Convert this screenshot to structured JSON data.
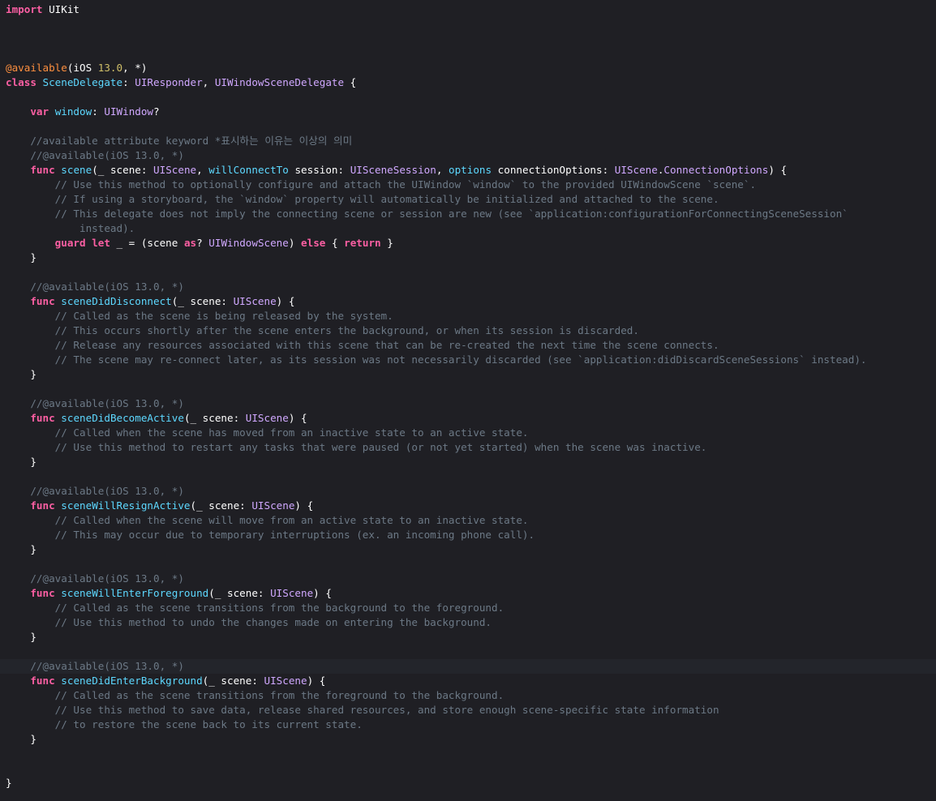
{
  "editor": {
    "theme": {
      "background": "#1f1f24",
      "current_line": "#23252b",
      "plain": "#ffffff",
      "keyword": "#fc5fa3",
      "comment": "#6c7986",
      "attribute": "#fd8f3f",
      "number": "#d0bf69",
      "declaration": "#5dd8ff",
      "type": "#d0a8ff"
    },
    "current_line_index": 45,
    "lines": [
      [
        [
          "kw",
          "import"
        ],
        [
          "plain",
          " UIKit"
        ]
      ],
      [],
      [],
      [],
      [
        [
          "attr",
          "@available"
        ],
        [
          "plain",
          "(iOS "
        ],
        [
          "num",
          "13.0"
        ],
        [
          "plain",
          ", *)"
        ]
      ],
      [
        [
          "kw",
          "class"
        ],
        [
          "plain",
          " "
        ],
        [
          "decl",
          "SceneDelegate"
        ],
        [
          "plain",
          ": "
        ],
        [
          "type",
          "UIResponder"
        ],
        [
          "plain",
          ", "
        ],
        [
          "type",
          "UIWindowSceneDelegate"
        ],
        [
          "plain",
          " {"
        ]
      ],
      [],
      [
        [
          "plain",
          "    "
        ],
        [
          "kw",
          "var"
        ],
        [
          "plain",
          " "
        ],
        [
          "decl",
          "window"
        ],
        [
          "plain",
          ": "
        ],
        [
          "type",
          "UIWindow"
        ],
        [
          "plain",
          "?"
        ]
      ],
      [],
      [
        [
          "plain",
          "    "
        ],
        [
          "comment",
          "//available attribute keyword *표시하는 이유는 이상의 의미"
        ]
      ],
      [
        [
          "plain",
          "    "
        ],
        [
          "comment",
          "//@available(iOS 13.0, *)"
        ]
      ],
      [
        [
          "plain",
          "    "
        ],
        [
          "kw",
          "func"
        ],
        [
          "plain",
          " "
        ],
        [
          "decl",
          "scene"
        ],
        [
          "plain",
          "(_ scene: "
        ],
        [
          "type",
          "UIScene"
        ],
        [
          "plain",
          ", "
        ],
        [
          "decl",
          "willConnectTo"
        ],
        [
          "plain",
          " session: "
        ],
        [
          "type",
          "UISceneSession"
        ],
        [
          "plain",
          ", "
        ],
        [
          "decl",
          "options"
        ],
        [
          "plain",
          " connectionOptions: "
        ],
        [
          "type",
          "UIScene"
        ],
        [
          "plain",
          "."
        ],
        [
          "type",
          "ConnectionOptions"
        ],
        [
          "plain",
          ") {"
        ]
      ],
      [
        [
          "plain",
          "        "
        ],
        [
          "comment",
          "// Use this method to optionally configure and attach the UIWindow `window` to the provided UIWindowScene `scene`."
        ]
      ],
      [
        [
          "plain",
          "        "
        ],
        [
          "comment",
          "// If using a storyboard, the `window` property will automatically be initialized and attached to the scene."
        ]
      ],
      [
        [
          "plain",
          "        "
        ],
        [
          "comment",
          "// This delegate does not imply the connecting scene or session are new (see `application:configurationForConnectingSceneSession`"
        ]
      ],
      [
        [
          "plain",
          "            "
        ],
        [
          "comment",
          "instead)."
        ]
      ],
      [
        [
          "plain",
          "        "
        ],
        [
          "kw",
          "guard"
        ],
        [
          "plain",
          " "
        ],
        [
          "kw",
          "let"
        ],
        [
          "plain",
          " _ = (scene "
        ],
        [
          "kw",
          "as"
        ],
        [
          "plain",
          "? "
        ],
        [
          "type",
          "UIWindowScene"
        ],
        [
          "plain",
          ") "
        ],
        [
          "kw",
          "else"
        ],
        [
          "plain",
          " { "
        ],
        [
          "kw",
          "return"
        ],
        [
          "plain",
          " }"
        ]
      ],
      [
        [
          "plain",
          "    }"
        ]
      ],
      [],
      [
        [
          "plain",
          "    "
        ],
        [
          "comment",
          "//@available(iOS 13.0, *)"
        ]
      ],
      [
        [
          "plain",
          "    "
        ],
        [
          "kw",
          "func"
        ],
        [
          "plain",
          " "
        ],
        [
          "decl",
          "sceneDidDisconnect"
        ],
        [
          "plain",
          "(_ scene: "
        ],
        [
          "type",
          "UIScene"
        ],
        [
          "plain",
          ") {"
        ]
      ],
      [
        [
          "plain",
          "        "
        ],
        [
          "comment",
          "// Called as the scene is being released by the system."
        ]
      ],
      [
        [
          "plain",
          "        "
        ],
        [
          "comment",
          "// This occurs shortly after the scene enters the background, or when its session is discarded."
        ]
      ],
      [
        [
          "plain",
          "        "
        ],
        [
          "comment",
          "// Release any resources associated with this scene that can be re-created the next time the scene connects."
        ]
      ],
      [
        [
          "plain",
          "        "
        ],
        [
          "comment",
          "// The scene may re-connect later, as its session was not necessarily discarded (see `application:didDiscardSceneSessions` instead)."
        ]
      ],
      [
        [
          "plain",
          "    }"
        ]
      ],
      [],
      [
        [
          "plain",
          "    "
        ],
        [
          "comment",
          "//@available(iOS 13.0, *)"
        ]
      ],
      [
        [
          "plain",
          "    "
        ],
        [
          "kw",
          "func"
        ],
        [
          "plain",
          " "
        ],
        [
          "decl",
          "sceneDidBecomeActive"
        ],
        [
          "plain",
          "(_ scene: "
        ],
        [
          "type",
          "UIScene"
        ],
        [
          "plain",
          ") {"
        ]
      ],
      [
        [
          "plain",
          "        "
        ],
        [
          "comment",
          "// Called when the scene has moved from an inactive state to an active state."
        ]
      ],
      [
        [
          "plain",
          "        "
        ],
        [
          "comment",
          "// Use this method to restart any tasks that were paused (or not yet started) when the scene was inactive."
        ]
      ],
      [
        [
          "plain",
          "    }"
        ]
      ],
      [],
      [
        [
          "plain",
          "    "
        ],
        [
          "comment",
          "//@available(iOS 13.0, *)"
        ]
      ],
      [
        [
          "plain",
          "    "
        ],
        [
          "kw",
          "func"
        ],
        [
          "plain",
          " "
        ],
        [
          "decl",
          "sceneWillResignActive"
        ],
        [
          "plain",
          "(_ scene: "
        ],
        [
          "type",
          "UIScene"
        ],
        [
          "plain",
          ") {"
        ]
      ],
      [
        [
          "plain",
          "        "
        ],
        [
          "comment",
          "// Called when the scene will move from an active state to an inactive state."
        ]
      ],
      [
        [
          "plain",
          "        "
        ],
        [
          "comment",
          "// This may occur due to temporary interruptions (ex. an incoming phone call)."
        ]
      ],
      [
        [
          "plain",
          "    }"
        ]
      ],
      [],
      [
        [
          "plain",
          "    "
        ],
        [
          "comment",
          "//@available(iOS 13.0, *)"
        ]
      ],
      [
        [
          "plain",
          "    "
        ],
        [
          "kw",
          "func"
        ],
        [
          "plain",
          " "
        ],
        [
          "decl",
          "sceneWillEnterForeground"
        ],
        [
          "plain",
          "(_ scene: "
        ],
        [
          "type",
          "UIScene"
        ],
        [
          "plain",
          ") {"
        ]
      ],
      [
        [
          "plain",
          "        "
        ],
        [
          "comment",
          "// Called as the scene transitions from the background to the foreground."
        ]
      ],
      [
        [
          "plain",
          "        "
        ],
        [
          "comment",
          "// Use this method to undo the changes made on entering the background."
        ]
      ],
      [
        [
          "plain",
          "    }"
        ]
      ],
      [],
      [
        [
          "plain",
          "    "
        ],
        [
          "comment",
          "//@available(iOS 13.0, *)"
        ]
      ],
      [
        [
          "plain",
          "    "
        ],
        [
          "kw",
          "func"
        ],
        [
          "plain",
          " "
        ],
        [
          "decl",
          "sceneDidEnterBackground"
        ],
        [
          "plain",
          "(_ scene: "
        ],
        [
          "type",
          "UIScene"
        ],
        [
          "plain",
          ") {"
        ]
      ],
      [
        [
          "plain",
          "        "
        ],
        [
          "comment",
          "// Called as the scene transitions from the foreground to the background."
        ]
      ],
      [
        [
          "plain",
          "        "
        ],
        [
          "comment",
          "// Use this method to save data, release shared resources, and store enough scene-specific state information"
        ]
      ],
      [
        [
          "plain",
          "        "
        ],
        [
          "comment",
          "// to restore the scene back to its current state."
        ]
      ],
      [
        [
          "plain",
          "    }"
        ]
      ],
      [],
      [],
      [
        [
          "plain",
          "}"
        ]
      ]
    ]
  }
}
